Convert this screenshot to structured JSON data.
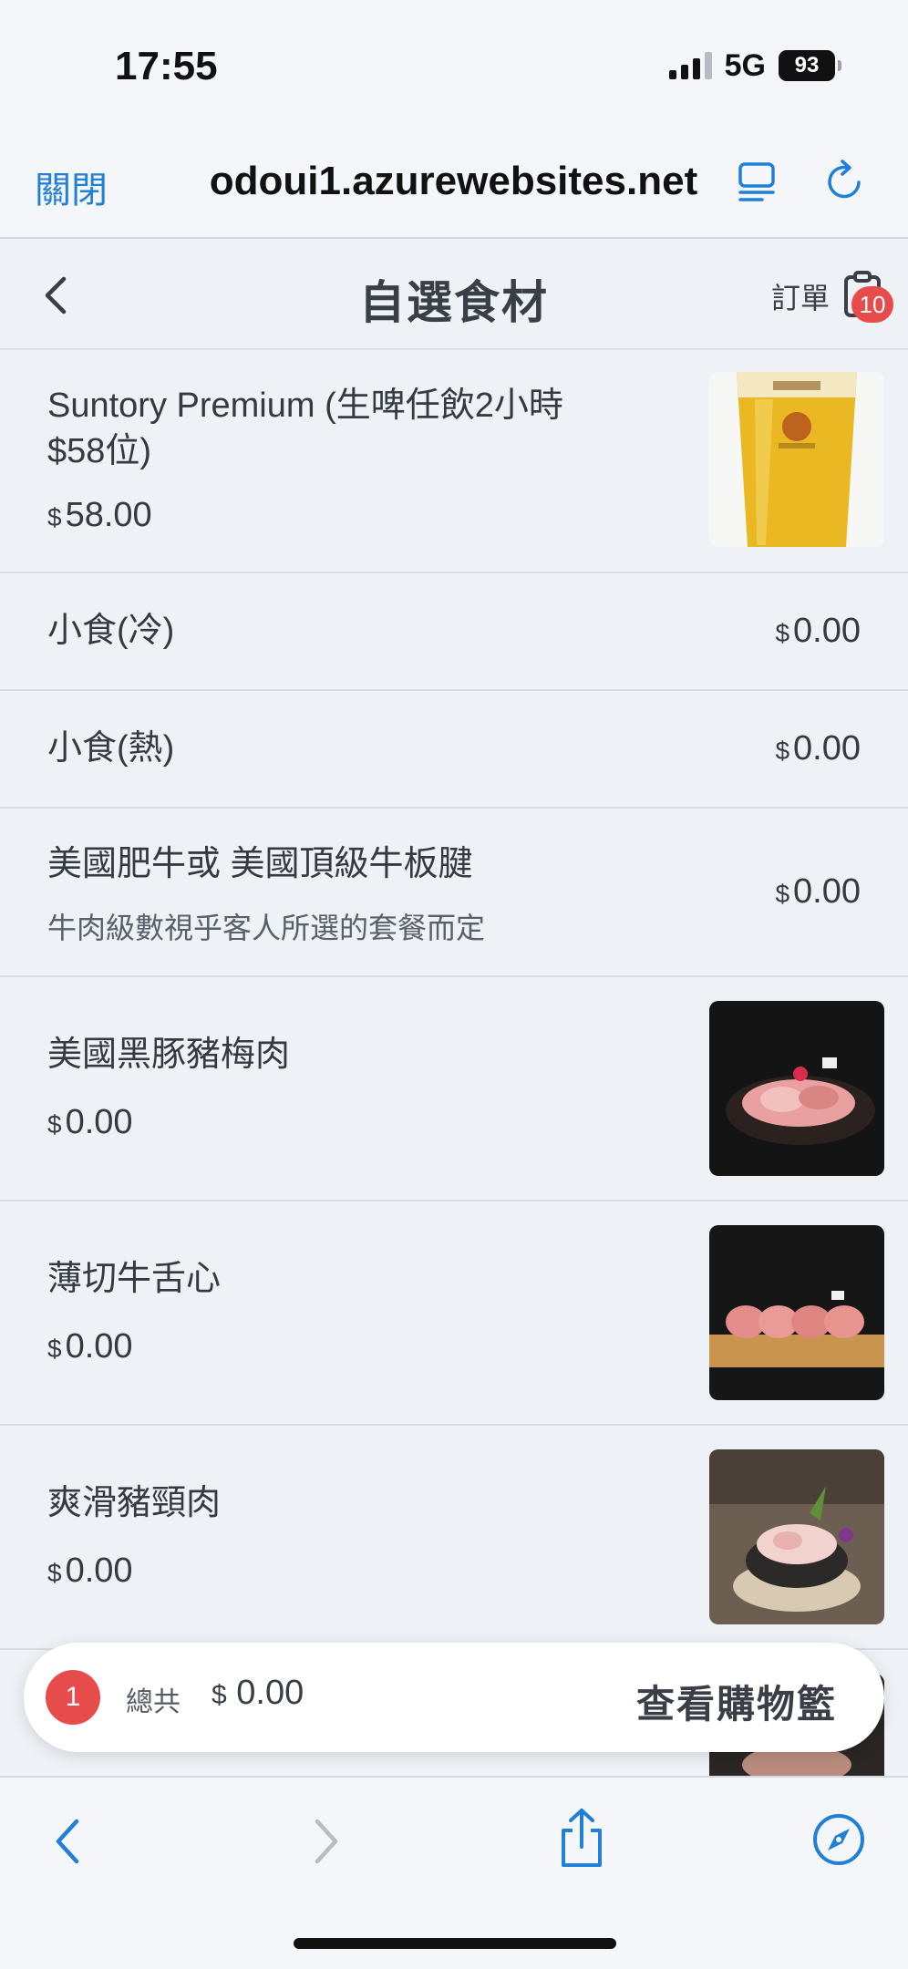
{
  "status_bar": {
    "time": "17:55",
    "network": "5G",
    "battery": "93"
  },
  "browser": {
    "close_label": "關閉",
    "url": "odoui1.azurewebsites.net"
  },
  "header": {
    "title": "自選食材",
    "order_label": "訂單",
    "order_badge": "10"
  },
  "items": [
    {
      "name_line1": "Suntory Premium (生啤任飲2小時",
      "name_line2": "$58位)",
      "currency": "$",
      "price": "58.00",
      "has_image": true
    },
    {
      "name": "小食(冷)",
      "currency": "$",
      "price": "0.00"
    },
    {
      "name": "小食(熱)",
      "currency": "$",
      "price": "0.00"
    },
    {
      "name": "美國肥牛或 美國頂級牛板腱",
      "description": "牛肉級數視乎客人所選的套餐而定",
      "currency": "$",
      "price": "0.00"
    },
    {
      "name": "美國黑豚豬梅肉",
      "currency": "$",
      "price": "0.00",
      "has_image": true
    },
    {
      "name": "薄切牛舌心",
      "currency": "$",
      "price": "0.00",
      "has_image": true
    },
    {
      "name": "爽滑豬頸肉",
      "currency": "$",
      "price": "0.00",
      "has_image": true
    }
  ],
  "cart": {
    "count": "1",
    "total_label": "總共",
    "currency": "$",
    "total": "0.00",
    "view_label": "查看購物籃"
  },
  "colors": {
    "accent_blue": "#1f7fd9",
    "badge_red": "#e84b4b",
    "page_bg": "#ecf0f5"
  }
}
